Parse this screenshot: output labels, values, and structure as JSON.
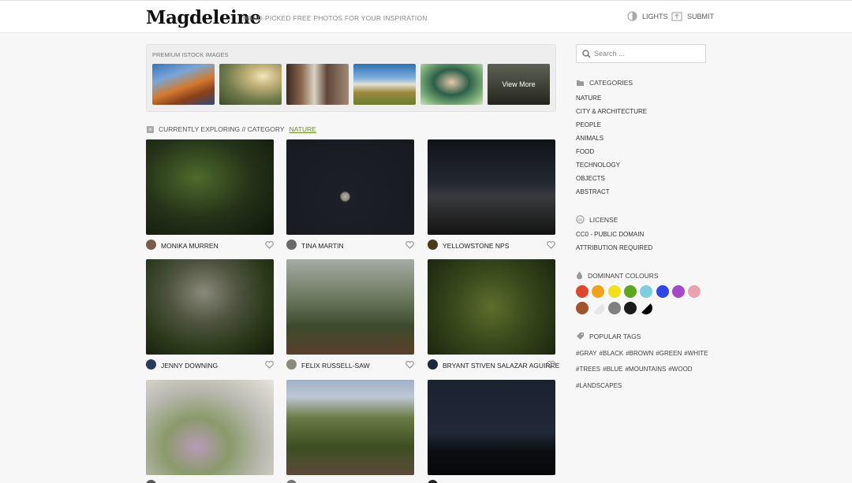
{
  "header": {
    "logo": "Magdeleine",
    "tagline": "HAND-PICKED FREE PHOTOS FOR YOUR INSPIRATION",
    "lights_label": "LIGHTS",
    "submit_label": "SUBMIT"
  },
  "premium": {
    "label": "PREMIUM ISTOCK IMAGES",
    "view_more": "View More"
  },
  "explore": {
    "prefix": "CURRENTLY EXPLORING // CATEGORY",
    "category": "NATURE"
  },
  "photos": [
    {
      "author": "MONIKA MURREN"
    },
    {
      "author": "TINA MARTIN"
    },
    {
      "author": "YELLOWSTONE NPS"
    },
    {
      "author": "JENNY DOWNING"
    },
    {
      "author": "FELIX RUSSELL-SAW"
    },
    {
      "author": "BRYANT STIVEN SALAZAR AGUIRRE"
    },
    {
      "author": ""
    },
    {
      "author": ""
    },
    {
      "author": ""
    }
  ],
  "search": {
    "placeholder": "Search ..."
  },
  "sidebar": {
    "categories_title": "CATEGORIES",
    "categories": [
      "NATURE",
      "CITY & ARCHITECTURE",
      "PEOPLE",
      "ANIMALS",
      "FOOD",
      "TECHNOLOGY",
      "OBJECTS",
      "ABSTRACT"
    ],
    "license_title": "LICENSE",
    "licenses": [
      "CC0 - PUBLIC DOMAIN",
      "ATTRIBUTION REQUIRED"
    ],
    "colours_title": "DOMINANT COLOURS",
    "colours": [
      "#e0452f",
      "#f0a21a",
      "#f2e11a",
      "#5ea61e",
      "#7ecde0",
      "#2f46e8",
      "#a447c9",
      "#e8a3b0",
      "#a2532c",
      "#eeeeee",
      "#808080",
      "#1b1b1b",
      "#000000"
    ],
    "tags_title": "POPULAR TAGS",
    "tags_row1": [
      "#GRAY",
      "#BLACK",
      "#BROWN",
      "#GREEN",
      "#WHITE"
    ],
    "tags_row2": [
      "#TREES",
      "#BLUE",
      "#MOUNTAINS",
      "#WOOD"
    ],
    "tags_row3": [
      "#LANDSCAPES"
    ]
  }
}
